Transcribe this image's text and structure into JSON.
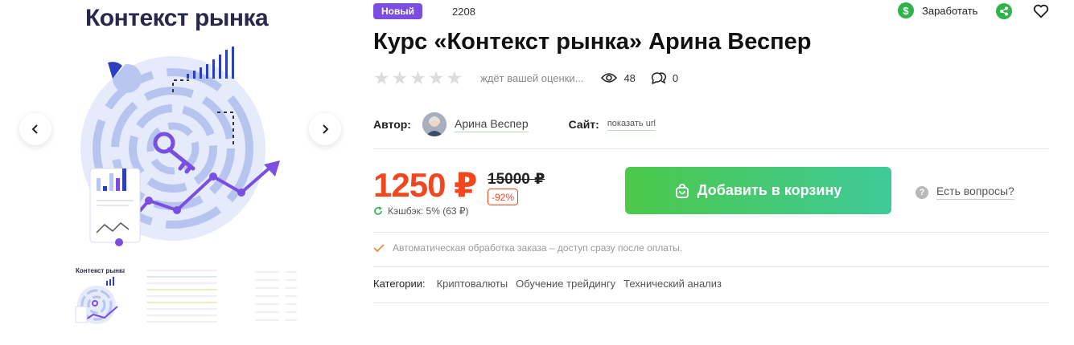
{
  "gallery": {
    "cover_title": "Контекст рынка",
    "thumb_title": "Контекст рынка",
    "prev_icon": "chevron-left-icon",
    "next_icon": "chevron-right-icon"
  },
  "product": {
    "badge": "Новый",
    "sku": "2208",
    "title": "Курс «Контекст рынка» Арина Веспер",
    "rating": {
      "value": 0,
      "max": 5,
      "text": "ждёт вашей оценки..."
    },
    "views": "48",
    "comments": "0"
  },
  "actions": {
    "earn_label": "Заработать",
    "earn_icon": "dollar-icon",
    "share_icon": "share-icon",
    "favorite_icon": "heart-icon"
  },
  "meta": {
    "author_label": "Автор:",
    "author_name": "Арина Веспер",
    "site_label": "Сайт:",
    "site_link": "показать url"
  },
  "pricing": {
    "price": "1250 ₽",
    "old_price": "15000 ₽",
    "discount": "-92%",
    "cashback": "Кэшбэк: 5% (63 ₽)",
    "cart_button": "Добавить в корзину",
    "questions": "Есть вопросы?"
  },
  "delivery_note": "Автоматическая обработка заказа – доступ сразу после оплаты.",
  "categories": {
    "label": "Категории:",
    "items": [
      "Криптовалюты",
      "Обучение трейдингу",
      "Технический анализ"
    ]
  },
  "colors": {
    "accent_red": "#f2461f",
    "brand_green": "#4cc84a",
    "badge_purple": "#7a4fe0"
  }
}
